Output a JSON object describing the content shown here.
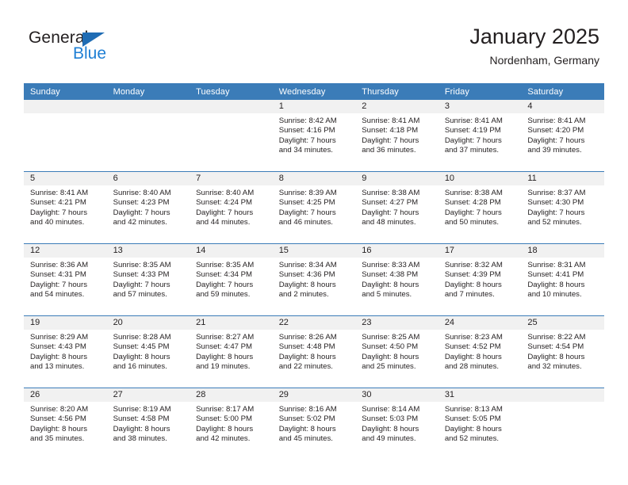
{
  "logo": {
    "word_top": "General",
    "word_bottom": "Blue",
    "accent_color": "#1f6cb4",
    "blue_text_color": "#1f7fd4"
  },
  "header": {
    "title": "January 2025",
    "subtitle": "Nordenham, Germany"
  },
  "theme": {
    "header_blue": "#3b7cb8",
    "band_gray": "#f1f1f1",
    "text": "#231f20",
    "page_background": "#ffffff"
  },
  "calendar": {
    "weekday_headers": [
      "Sunday",
      "Monday",
      "Tuesday",
      "Wednesday",
      "Thursday",
      "Friday",
      "Saturday"
    ],
    "weeks": [
      [
        {
          "day": "",
          "lines": []
        },
        {
          "day": "",
          "lines": []
        },
        {
          "day": "",
          "lines": []
        },
        {
          "day": "1",
          "lines": [
            "Sunrise: 8:42 AM",
            "Sunset: 4:16 PM",
            "Daylight: 7 hours",
            "and 34 minutes."
          ]
        },
        {
          "day": "2",
          "lines": [
            "Sunrise: 8:41 AM",
            "Sunset: 4:18 PM",
            "Daylight: 7 hours",
            "and 36 minutes."
          ]
        },
        {
          "day": "3",
          "lines": [
            "Sunrise: 8:41 AM",
            "Sunset: 4:19 PM",
            "Daylight: 7 hours",
            "and 37 minutes."
          ]
        },
        {
          "day": "4",
          "lines": [
            "Sunrise: 8:41 AM",
            "Sunset: 4:20 PM",
            "Daylight: 7 hours",
            "and 39 minutes."
          ]
        }
      ],
      [
        {
          "day": "5",
          "lines": [
            "Sunrise: 8:41 AM",
            "Sunset: 4:21 PM",
            "Daylight: 7 hours",
            "and 40 minutes."
          ]
        },
        {
          "day": "6",
          "lines": [
            "Sunrise: 8:40 AM",
            "Sunset: 4:23 PM",
            "Daylight: 7 hours",
            "and 42 minutes."
          ]
        },
        {
          "day": "7",
          "lines": [
            "Sunrise: 8:40 AM",
            "Sunset: 4:24 PM",
            "Daylight: 7 hours",
            "and 44 minutes."
          ]
        },
        {
          "day": "8",
          "lines": [
            "Sunrise: 8:39 AM",
            "Sunset: 4:25 PM",
            "Daylight: 7 hours",
            "and 46 minutes."
          ]
        },
        {
          "day": "9",
          "lines": [
            "Sunrise: 8:38 AM",
            "Sunset: 4:27 PM",
            "Daylight: 7 hours",
            "and 48 minutes."
          ]
        },
        {
          "day": "10",
          "lines": [
            "Sunrise: 8:38 AM",
            "Sunset: 4:28 PM",
            "Daylight: 7 hours",
            "and 50 minutes."
          ]
        },
        {
          "day": "11",
          "lines": [
            "Sunrise: 8:37 AM",
            "Sunset: 4:30 PM",
            "Daylight: 7 hours",
            "and 52 minutes."
          ]
        }
      ],
      [
        {
          "day": "12",
          "lines": [
            "Sunrise: 8:36 AM",
            "Sunset: 4:31 PM",
            "Daylight: 7 hours",
            "and 54 minutes."
          ]
        },
        {
          "day": "13",
          "lines": [
            "Sunrise: 8:35 AM",
            "Sunset: 4:33 PM",
            "Daylight: 7 hours",
            "and 57 minutes."
          ]
        },
        {
          "day": "14",
          "lines": [
            "Sunrise: 8:35 AM",
            "Sunset: 4:34 PM",
            "Daylight: 7 hours",
            "and 59 minutes."
          ]
        },
        {
          "day": "15",
          "lines": [
            "Sunrise: 8:34 AM",
            "Sunset: 4:36 PM",
            "Daylight: 8 hours",
            "and 2 minutes."
          ]
        },
        {
          "day": "16",
          "lines": [
            "Sunrise: 8:33 AM",
            "Sunset: 4:38 PM",
            "Daylight: 8 hours",
            "and 5 minutes."
          ]
        },
        {
          "day": "17",
          "lines": [
            "Sunrise: 8:32 AM",
            "Sunset: 4:39 PM",
            "Daylight: 8 hours",
            "and 7 minutes."
          ]
        },
        {
          "day": "18",
          "lines": [
            "Sunrise: 8:31 AM",
            "Sunset: 4:41 PM",
            "Daylight: 8 hours",
            "and 10 minutes."
          ]
        }
      ],
      [
        {
          "day": "19",
          "lines": [
            "Sunrise: 8:29 AM",
            "Sunset: 4:43 PM",
            "Daylight: 8 hours",
            "and 13 minutes."
          ]
        },
        {
          "day": "20",
          "lines": [
            "Sunrise: 8:28 AM",
            "Sunset: 4:45 PM",
            "Daylight: 8 hours",
            "and 16 minutes."
          ]
        },
        {
          "day": "21",
          "lines": [
            "Sunrise: 8:27 AM",
            "Sunset: 4:47 PM",
            "Daylight: 8 hours",
            "and 19 minutes."
          ]
        },
        {
          "day": "22",
          "lines": [
            "Sunrise: 8:26 AM",
            "Sunset: 4:48 PM",
            "Daylight: 8 hours",
            "and 22 minutes."
          ]
        },
        {
          "day": "23",
          "lines": [
            "Sunrise: 8:25 AM",
            "Sunset: 4:50 PM",
            "Daylight: 8 hours",
            "and 25 minutes."
          ]
        },
        {
          "day": "24",
          "lines": [
            "Sunrise: 8:23 AM",
            "Sunset: 4:52 PM",
            "Daylight: 8 hours",
            "and 28 minutes."
          ]
        },
        {
          "day": "25",
          "lines": [
            "Sunrise: 8:22 AM",
            "Sunset: 4:54 PM",
            "Daylight: 8 hours",
            "and 32 minutes."
          ]
        }
      ],
      [
        {
          "day": "26",
          "lines": [
            "Sunrise: 8:20 AM",
            "Sunset: 4:56 PM",
            "Daylight: 8 hours",
            "and 35 minutes."
          ]
        },
        {
          "day": "27",
          "lines": [
            "Sunrise: 8:19 AM",
            "Sunset: 4:58 PM",
            "Daylight: 8 hours",
            "and 38 minutes."
          ]
        },
        {
          "day": "28",
          "lines": [
            "Sunrise: 8:17 AM",
            "Sunset: 5:00 PM",
            "Daylight: 8 hours",
            "and 42 minutes."
          ]
        },
        {
          "day": "29",
          "lines": [
            "Sunrise: 8:16 AM",
            "Sunset: 5:02 PM",
            "Daylight: 8 hours",
            "and 45 minutes."
          ]
        },
        {
          "day": "30",
          "lines": [
            "Sunrise: 8:14 AM",
            "Sunset: 5:03 PM",
            "Daylight: 8 hours",
            "and 49 minutes."
          ]
        },
        {
          "day": "31",
          "lines": [
            "Sunrise: 8:13 AM",
            "Sunset: 5:05 PM",
            "Daylight: 8 hours",
            "and 52 minutes."
          ]
        },
        {
          "day": "",
          "lines": []
        }
      ]
    ]
  }
}
